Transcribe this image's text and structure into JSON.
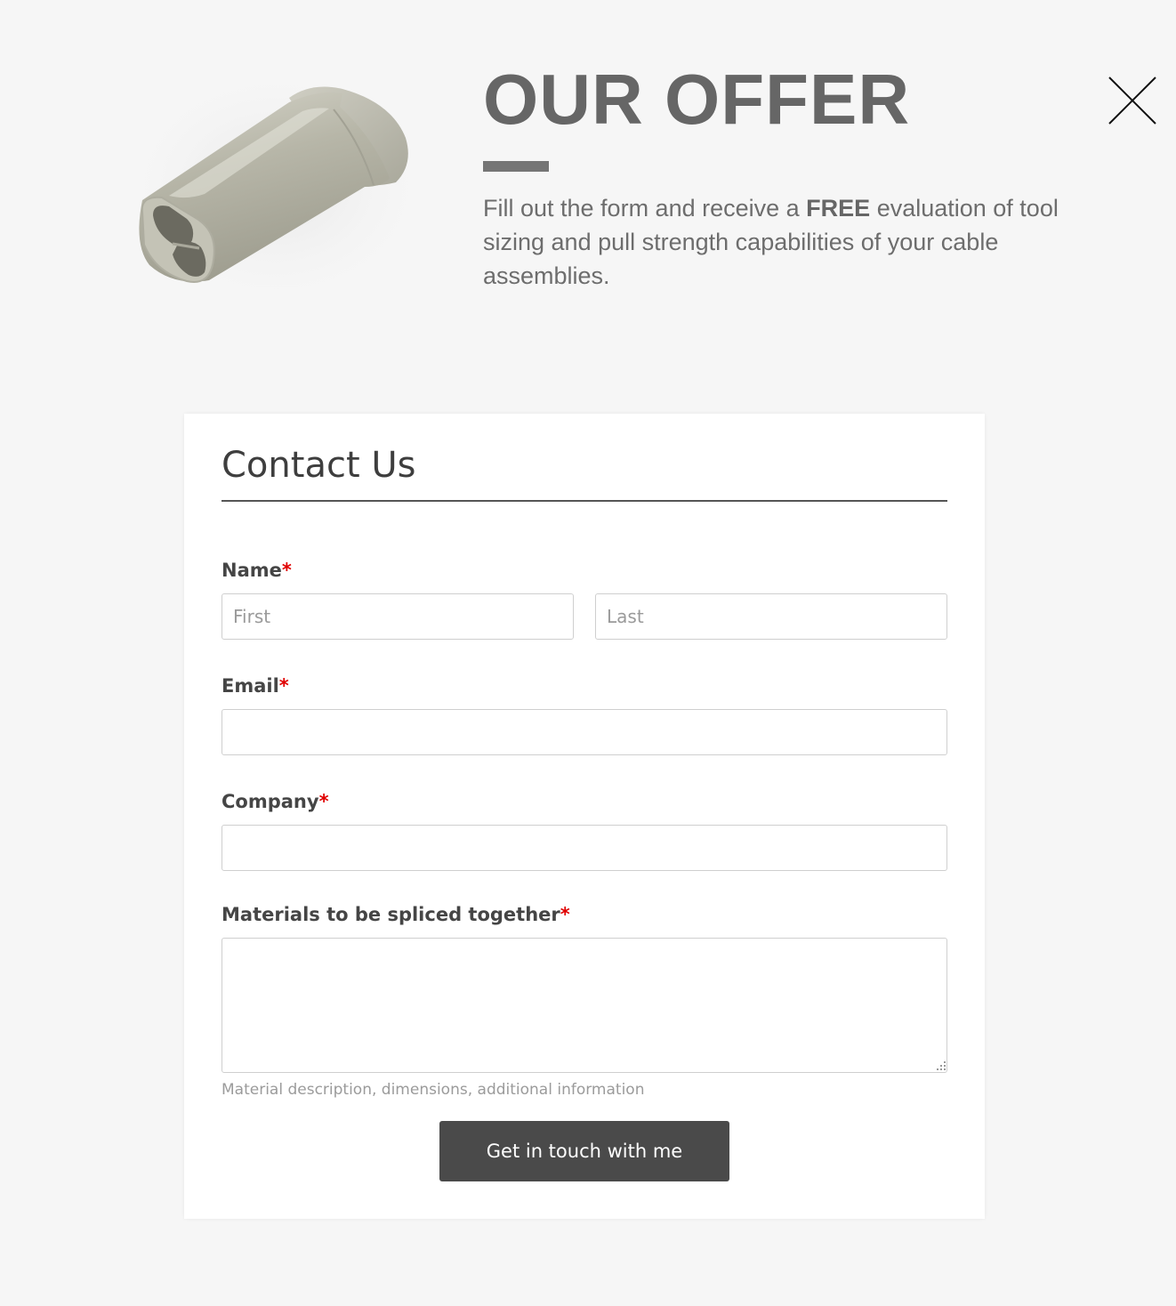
{
  "offer": {
    "title": "OUR OFFER",
    "text_before": "Fill out the form and receive a ",
    "text_bold": "FREE",
    "text_after": " evaluation of tool sizing and pull strength capabilities of your cable assemblies."
  },
  "product_image": {
    "alt": "splice sleeve"
  },
  "close_icon": "close-icon",
  "form": {
    "title": "Contact Us",
    "required_marker": "*",
    "name": {
      "label": "Name",
      "first_placeholder": "First",
      "last_placeholder": "Last",
      "first_value": "",
      "last_value": ""
    },
    "email": {
      "label": "Email",
      "value": ""
    },
    "company": {
      "label": "Company",
      "value": ""
    },
    "materials": {
      "label": "Materials to be spliced together",
      "value": "",
      "hint": "Material description, dimensions, additional information"
    },
    "submit_label": "Get in touch with me"
  },
  "colors": {
    "page_background": "#f6f6f6",
    "card_background": "#ffffff",
    "button_background": "#4a4a4a",
    "required_marker": "#e00000",
    "heading_gray": "#666666"
  }
}
